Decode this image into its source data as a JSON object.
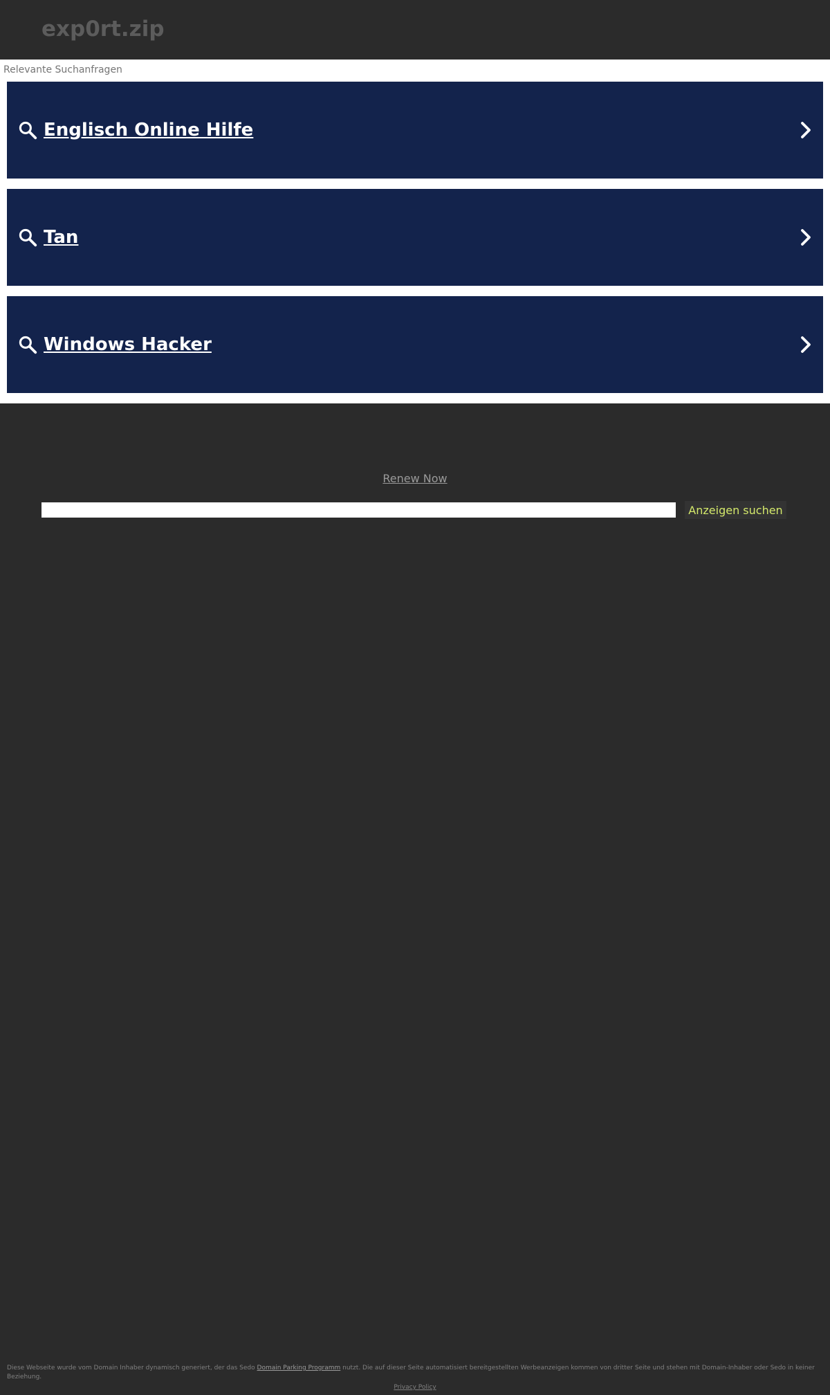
{
  "header": {
    "domain": "exp0rt.zip"
  },
  "results": {
    "label": "Relevante Suchanfragen",
    "items": [
      {
        "label": "Englisch Online Hilfe"
      },
      {
        "label": "Tan"
      },
      {
        "label": "Windows Hacker"
      }
    ]
  },
  "renew": {
    "label": "Renew Now"
  },
  "search": {
    "value": "",
    "button_label": "Anzeigen suchen"
  },
  "footer": {
    "text_before": "Diese Webseite wurde vom Domain Inhaber dynamisch generiert, der das Sedo ",
    "link_label": "Domain Parking Programm",
    "text_after": " nutzt. Die auf dieser Seite automatisiert bereitgestellten Werbeanzeigen kommen von dritter Seite und stehen mit Domain-Inhaber oder Sedo in keiner Beziehung.",
    "privacy_label": "Privacy Policy"
  },
  "colors": {
    "background": "#2b2b2b",
    "results_background": "#ffffff",
    "result_item": "#13234c",
    "search_button_text": "#d4e96b"
  }
}
